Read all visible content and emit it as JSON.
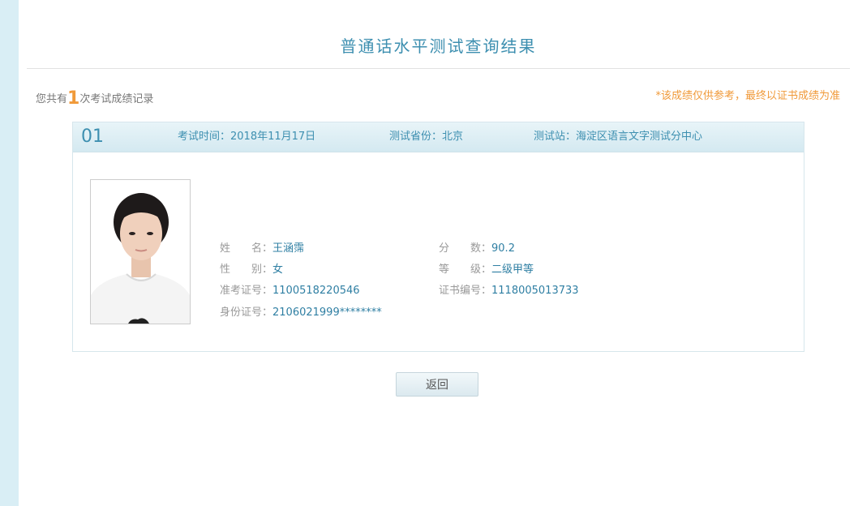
{
  "page": {
    "title": "普通话水平测试查询结果"
  },
  "summary": {
    "prefix": "您共有",
    "count": "1",
    "suffix": "次考试成绩记录",
    "notice": "*该成绩仅供参考，最终以证书成绩为准"
  },
  "record": {
    "index": "01",
    "exam_time_label": "考试时间：",
    "exam_time": "2018年11月17日",
    "province_label": "测试省份：",
    "province": "北京",
    "station_label": "测试站：",
    "station": "海淀区语言文字测试分中心",
    "name_label": "姓　　名：",
    "name": "王涵霈",
    "gender_label": "性　　别：",
    "gender": "女",
    "ticket_label": "准考证号：",
    "ticket": "1100518220546",
    "id_label": "身份证号：",
    "id": "2106021999********",
    "score_label": "分　　数：",
    "score": "90.2",
    "level_label": "等　　级：",
    "level": "二级甲等",
    "cert_label": "证书编号：",
    "cert": "1118005013733"
  },
  "actions": {
    "back_label": "返回"
  }
}
